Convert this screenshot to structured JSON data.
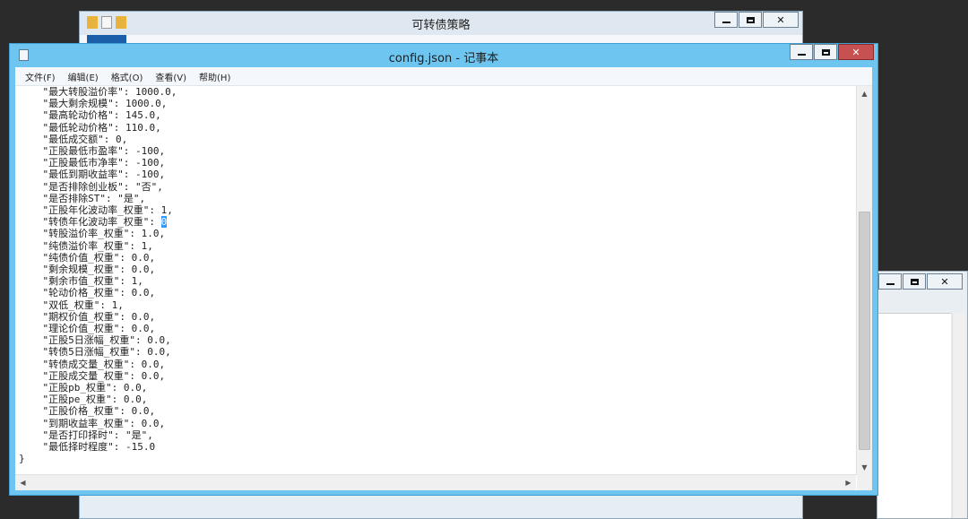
{
  "explorer": {
    "title": "可转债策略"
  },
  "notepad": {
    "title": "config.json - 记事本",
    "menu": [
      {
        "label": "文件(F)"
      },
      {
        "label": "编辑(E)"
      },
      {
        "label": "格式(O)"
      },
      {
        "label": "查看(V)"
      },
      {
        "label": "帮助(H)"
      }
    ],
    "lines_before": [
      "    \"最大转股溢价率\": 1000.0,",
      "    \"最大剩余规模\": 1000.0,",
      "    \"最高轮动价格\": 145.0,",
      "    \"最低轮动价格\": 110.0,",
      "    \"最低成交额\": 0,",
      "    \"正股最低市盈率\": -100,",
      "    \"正股最低市净率\": -100,",
      "    \"最低到期收益率\": -100,",
      "    \"是否排除创业板\": \"否\",",
      "    \"是否排除ST\": \"是\","
    ],
    "line_selected_prefix": "    \"正股年化波动率_权重\": 1,",
    "line_cursor_prefix": "    \"转债年化波动率_权重\": ",
    "selected_text": "0",
    "lines_after": [
      "    \"转股溢价率_权重\": 1.0,",
      "    \"纯债溢价率_权重\": 1,",
      "    \"纯债价值_权重\": 0.0,",
      "    \"剩余规模_权重\": 0.0,",
      "    \"剩余市值_权重\": 1,",
      "    \"轮动价格_权重\": 0.0,",
      "    \"双低_权重\": 1,",
      "    \"期权价值_权重\": 0.0,",
      "    \"理论价值_权重\": 0.0,",
      "    \"正股5日涨幅_权重\": 0.0,",
      "    \"转债5日涨幅_权重\": 0.0,",
      "    \"转债成交量_权重\": 0.0,",
      "    \"正股成交量_权重\": 0.0,",
      "    \"正股pb_权重\": 0.0,",
      "    \"正股pe_权重\": 0.0,",
      "    \"正股价格_权重\": 0.0,",
      "    \"到期收益率_权重\": 0.0,",
      "    \"是否打印择时\": \"是\",",
      "    \"最低择时程度\": -15.0",
      "}"
    ]
  }
}
